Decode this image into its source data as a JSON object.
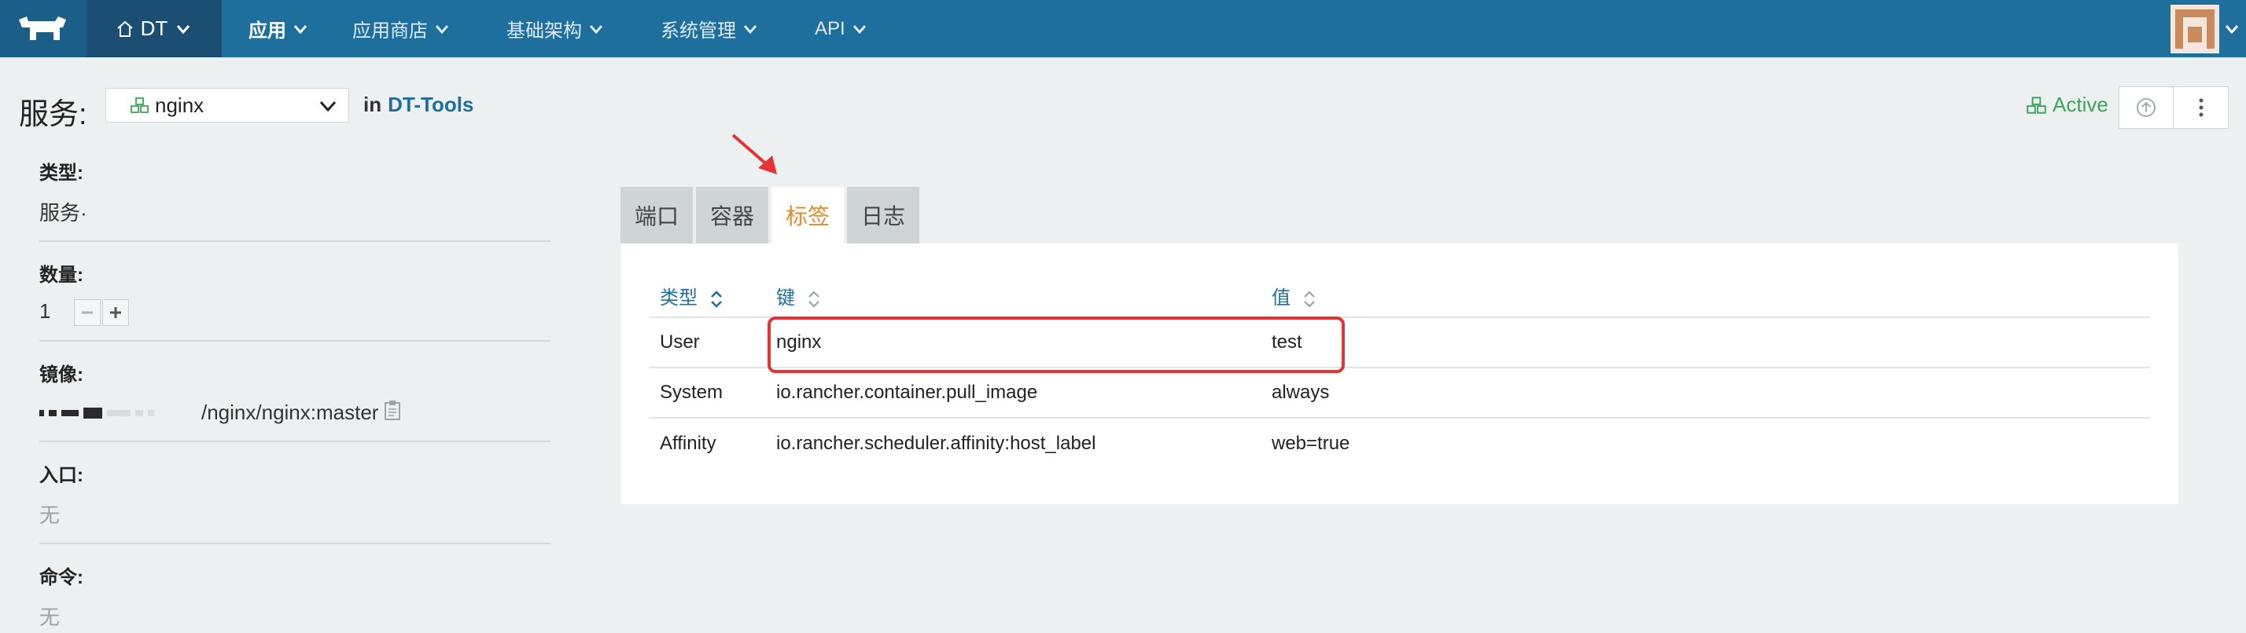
{
  "nav": {
    "env_label": "DT",
    "items": [
      {
        "label": "应用"
      },
      {
        "label": "应用商店"
      },
      {
        "label": "基础架构"
      },
      {
        "label": "系统管理"
      },
      {
        "label": "API"
      }
    ]
  },
  "header": {
    "title": "服务:",
    "service_name": "nginx",
    "in_prefix": "in",
    "stack_link": "DT-Tools",
    "status": "Active"
  },
  "info": {
    "type_label": "类型:",
    "type_value": "服务·",
    "scale_label": "数量:",
    "scale_value": "1",
    "image_label": "镜像:",
    "image_value": "/nginx/nginx:master",
    "entry_label": "入口:",
    "entry_value": "无",
    "command_label": "命令:",
    "command_value": "无"
  },
  "tabs": [
    {
      "label": "端口"
    },
    {
      "label": "容器"
    },
    {
      "label": "标签"
    },
    {
      "label": "日志"
    }
  ],
  "labels_table": {
    "columns": [
      "类型",
      "键",
      "值"
    ],
    "rows": [
      {
        "type": "User",
        "key": "nginx",
        "value": "test"
      },
      {
        "type": "System",
        "key": "io.rancher.container.pull_image",
        "value": "always"
      },
      {
        "type": "Affinity",
        "key": "io.rancher.scheduler.affinity:host_label",
        "value": "web=true"
      }
    ]
  },
  "colors": {
    "topbar": "#1f6f9e",
    "accent_link": "#1f6f9e",
    "active_tab": "#e08a2e",
    "status_active": "#3aa758",
    "annotation": "#e63232"
  }
}
